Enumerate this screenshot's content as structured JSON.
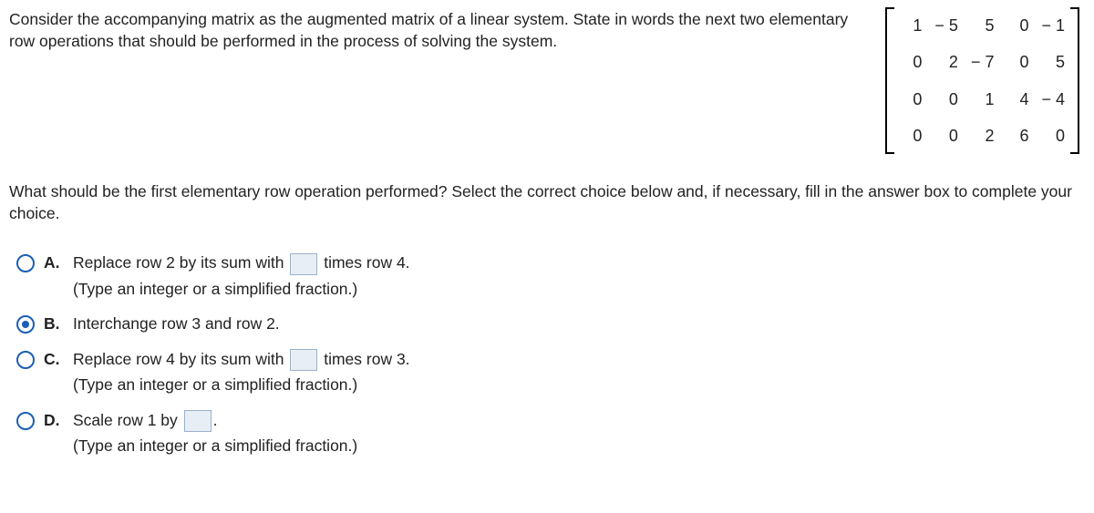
{
  "intro": "Consider the accompanying matrix as the augmented matrix of a linear system. State in words the next two elementary row operations that should be performed in the process of solving the system.",
  "matrix": {
    "r1": {
      "c1": "1",
      "c2": "− 5",
      "c3": "5",
      "c4": "0",
      "c5": "− 1"
    },
    "r2": {
      "c1": "0",
      "c2": "2",
      "c3": "− 7",
      "c4": "0",
      "c5": "5"
    },
    "r3": {
      "c1": "0",
      "c2": "0",
      "c3": "1",
      "c4": "4",
      "c5": "− 4"
    },
    "r4": {
      "c1": "0",
      "c2": "0",
      "c3": "2",
      "c4": "6",
      "c5": "0"
    }
  },
  "question": "What should be the first elementary row operation performed? Select the correct choice below and, if necessary, fill in the answer box to complete your choice.",
  "hint": "(Type an integer or a simplified fraction.)",
  "choices": {
    "A": {
      "letter": "A.",
      "pre": "Replace row 2 by its sum with ",
      "post": " times row 4."
    },
    "B": {
      "letter": "B.",
      "text": "Interchange row 3 and row 2."
    },
    "C": {
      "letter": "C.",
      "pre": "Replace row 4 by its sum with ",
      "post": " times row 3."
    },
    "D": {
      "letter": "D.",
      "pre": "Scale row 1 by ",
      "post": "."
    }
  },
  "selected": "B"
}
